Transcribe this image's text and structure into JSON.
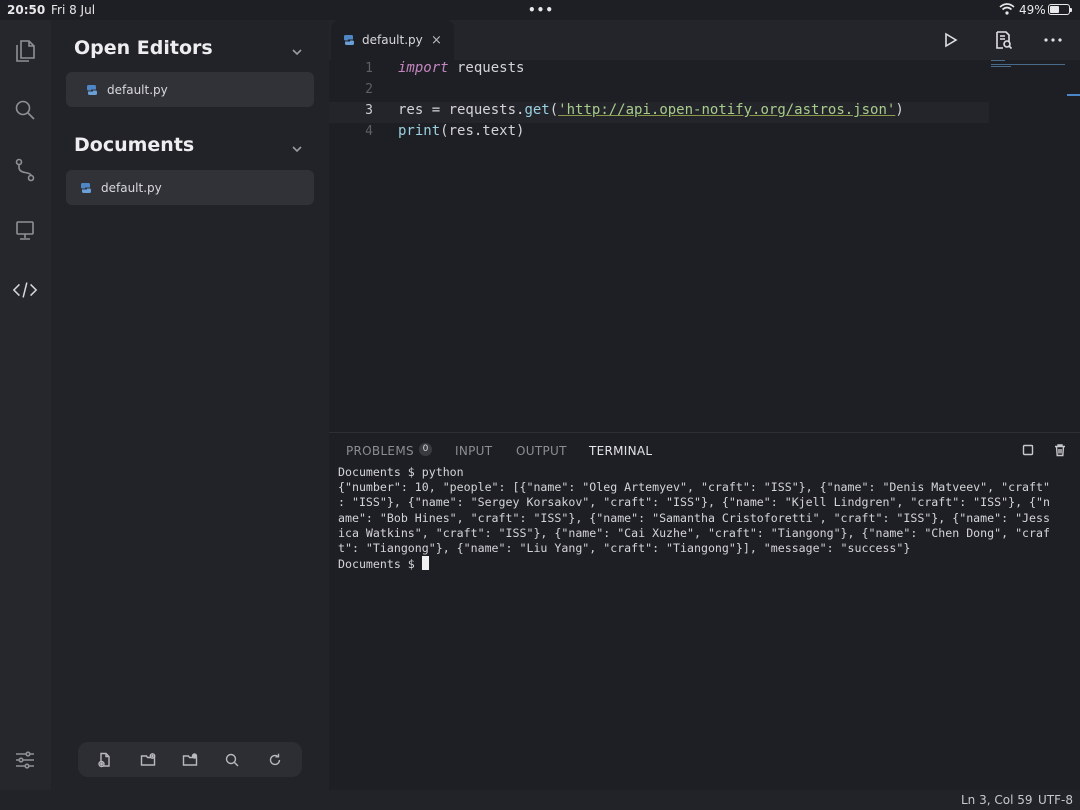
{
  "status_bar": {
    "time": "20:50",
    "date": "Fri 8 Jul",
    "dots": "•••",
    "battery_percent": "49%",
    "battery_level": 0.49
  },
  "activity_bar": {
    "items": [
      {
        "icon": "files-icon",
        "active": false
      },
      {
        "icon": "search-icon",
        "active": false
      },
      {
        "icon": "source-control-icon",
        "active": false
      },
      {
        "icon": "remote-icon",
        "active": false
      },
      {
        "icon": "code-icon",
        "active": true
      }
    ],
    "settings_icon": "settings-sliders-icon"
  },
  "sidebar": {
    "open_editors": {
      "title": "Open Editors",
      "files": [
        {
          "name": "default.py"
        }
      ]
    },
    "documents": {
      "title": "Documents",
      "files": [
        {
          "name": "default.py"
        }
      ]
    },
    "toolbar": [
      "new-file-icon",
      "new-folder-icon",
      "open-folder-icon",
      "search-icon",
      "refresh-icon"
    ]
  },
  "editor": {
    "tab": {
      "name": "default.py",
      "close": "×"
    },
    "toolbar": [
      "run-icon",
      "preview-icon",
      "more-icon"
    ],
    "current_line": 3,
    "lines": [
      {
        "number": "1",
        "keyword": "import",
        "rest": " requests"
      },
      {
        "number": "2"
      },
      {
        "number": "3",
        "prefix": "res = requests.",
        "fn": "get",
        "open": "(",
        "string": "'http://api.open-notify.org/astros.json'",
        "close": ")"
      },
      {
        "number": "4",
        "fn": "print",
        "rest": "(res.text)"
      }
    ]
  },
  "panel": {
    "tabs": [
      {
        "label": "PROBLEMS",
        "active": false
      },
      {
        "label": "INPUT",
        "active": false
      },
      {
        "label": "OUTPUT",
        "active": false
      },
      {
        "label": "TERMINAL",
        "active": true
      }
    ],
    "problems_count": "0",
    "terminal_lines": [
      "Documents $ python",
      "{\"number\": 10, \"people\": [{\"name\": \"Oleg Artemyev\", \"craft\": \"ISS\"}, {\"name\": \"Denis Matveev\", \"craft\"",
      ": \"ISS\"}, {\"name\": \"Sergey Korsakov\", \"craft\": \"ISS\"}, {\"name\": \"Kjell Lindgren\", \"craft\": \"ISS\"}, {\"n",
      "ame\": \"Bob Hines\", \"craft\": \"ISS\"}, {\"name\": \"Samantha Cristoforetti\", \"craft\": \"ISS\"}, {\"name\": \"Jess",
      "ica Watkins\", \"craft\": \"ISS\"}, {\"name\": \"Cai Xuzhe\", \"craft\": \"Tiangong\"}, {\"name\": \"Chen Dong\", \"craf",
      "t\": \"Tiangong\"}, {\"name\": \"Liu Yang\", \"craft\": \"Tiangong\"}], \"message\": \"success\"}"
    ],
    "prompt": "Documents $ "
  },
  "bottom_status": {
    "position": "Ln 3, Col 59",
    "encoding": "UTF-8"
  },
  "colors": {
    "keyword": "#c586c0",
    "function": "#9ad0e0",
    "string": "#a8cc8c",
    "accent": "#4a86c8"
  }
}
